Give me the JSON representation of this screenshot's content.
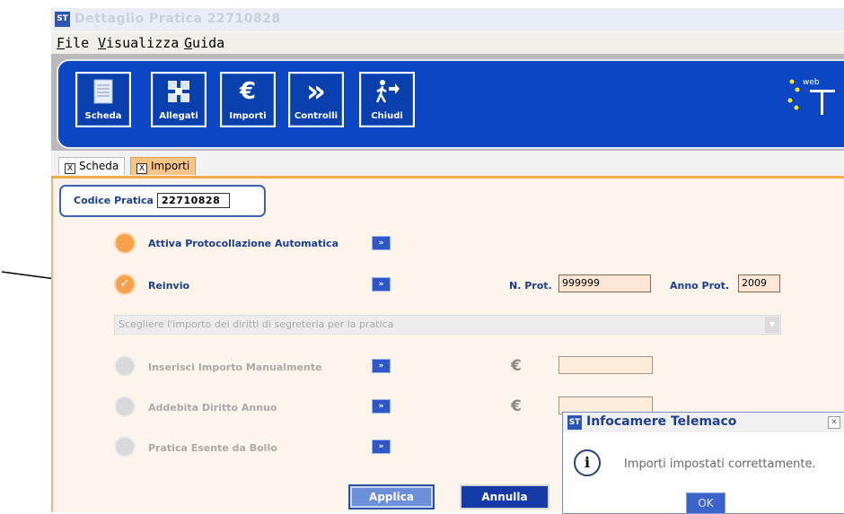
{
  "window": {
    "title": "Dettaglio Pratica 22710828",
    "icon": "app-icon",
    "icon_text": "ST"
  },
  "menu": [
    "File",
    "Visualizza",
    "Guida"
  ],
  "toolbar": {
    "buttons": [
      {
        "label": "Scheda",
        "icon": "document-icon"
      },
      {
        "label": "Allegati",
        "icon": "attachments-icon"
      },
      {
        "label": "Importi",
        "icon": "euro-icon",
        "glyph": "€"
      },
      {
        "label": "Controlli",
        "icon": "forward-icon",
        "glyph": "»"
      },
      {
        "label": "Chiudi",
        "icon": "exit-icon"
      }
    ],
    "logo_text": "web"
  },
  "tabs": [
    {
      "label": "Scheda",
      "active": false
    },
    {
      "label": "Importi",
      "active": true
    }
  ],
  "tab_close_glyph": "X",
  "codice": {
    "label": "Codice Pratica",
    "value": "22710828"
  },
  "options": [
    {
      "label": "Attiva Protocollazione Automatica",
      "state": "on"
    },
    {
      "label": "Reinvio",
      "state": "checked"
    },
    {
      "label": "Inserisci Importo Manualmente",
      "state": "disabled"
    },
    {
      "label": "Addebita Diritto Annuo",
      "state": "disabled"
    },
    {
      "label": "Pratica Esente da Bollo",
      "state": "disabled"
    }
  ],
  "arrow_glyph": "»",
  "prot": {
    "n_label": "N. Prot.",
    "n_value": "999999",
    "anno_label": "Anno Prot.",
    "anno_value": "2009"
  },
  "combo": {
    "placeholder": "Scegliere l'importo dei diritti di segreteria per la pratica"
  },
  "euro_symbol": "€",
  "buttons": {
    "applica": "Applica",
    "annulla": "Annulla"
  },
  "dialog": {
    "title": "Infocamere Telemaco",
    "message": "Importi impostati correttamente.",
    "ok": "OK",
    "info_glyph": "i"
  },
  "colors": {
    "toolbar_blue": "#0b47c4",
    "active_radio": "#f6a24c",
    "tab_active": "#f7c487"
  }
}
